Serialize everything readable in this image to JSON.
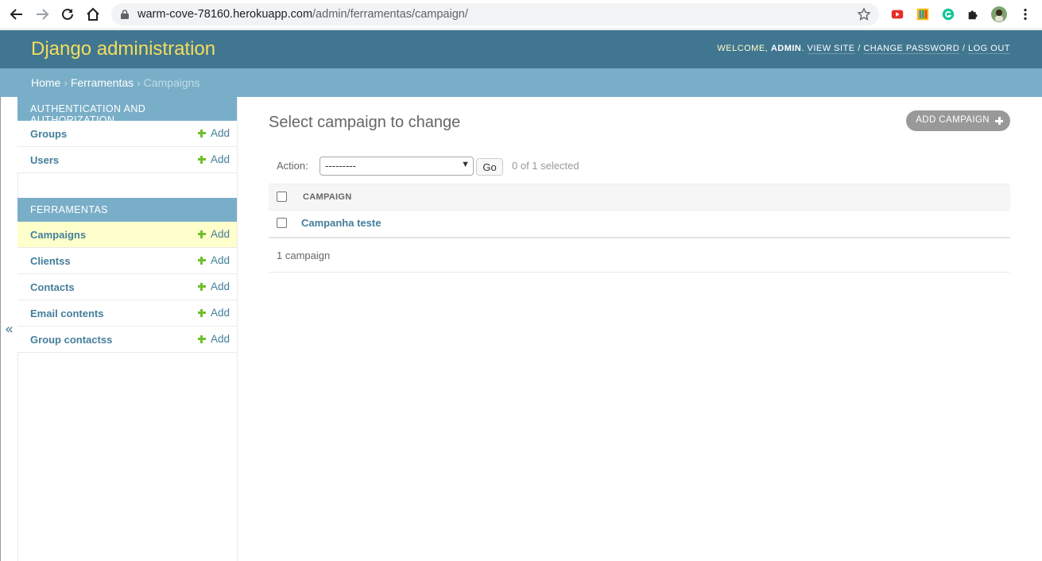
{
  "browser": {
    "url_host": "warm-cove-78160.herokuapp.com",
    "url_path": "/admin/ferramentas/campaign/"
  },
  "header": {
    "branding": "Django administration",
    "welcome": "Welcome,",
    "username": "admin",
    "view_site": "View site",
    "change_password": "Change password",
    "log_out": "Log out",
    "separator": "/"
  },
  "breadcrumbs": {
    "home": "Home",
    "app": "Ferramentas",
    "current": "Campaigns",
    "sep": "›"
  },
  "sidebar": {
    "toggle": "«",
    "modules": [
      {
        "caption": "Authentication and Authorization",
        "items": [
          {
            "label": "Groups",
            "add": "Add"
          },
          {
            "label": "Users",
            "add": "Add"
          }
        ]
      },
      {
        "caption": "Ferramentas",
        "items": [
          {
            "label": "Campaigns",
            "add": "Add",
            "current": true
          },
          {
            "label": "Clientss",
            "add": "Add"
          },
          {
            "label": "Contacts",
            "add": "Add"
          },
          {
            "label": "Email contents",
            "add": "Add"
          },
          {
            "label": "Group contactss",
            "add": "Add"
          }
        ]
      }
    ]
  },
  "main": {
    "title": "Select campaign to change",
    "add_button": "Add campaign",
    "actions": {
      "label": "Action:",
      "selected_value": "---------",
      "go": "Go",
      "counter": "0 of 1 selected"
    },
    "table": {
      "columns": [
        "Campaign"
      ],
      "rows": [
        [
          "Campanha teste"
        ]
      ]
    },
    "paginator": "1 campaign"
  },
  "colors": {
    "header_bg": "#417690",
    "branding": "#f5dd5d",
    "breadcrumbs_bg": "#79aec8",
    "link": "#447e9b",
    "add_icon": "#70bf2b",
    "current_row": "#ffffcc"
  }
}
